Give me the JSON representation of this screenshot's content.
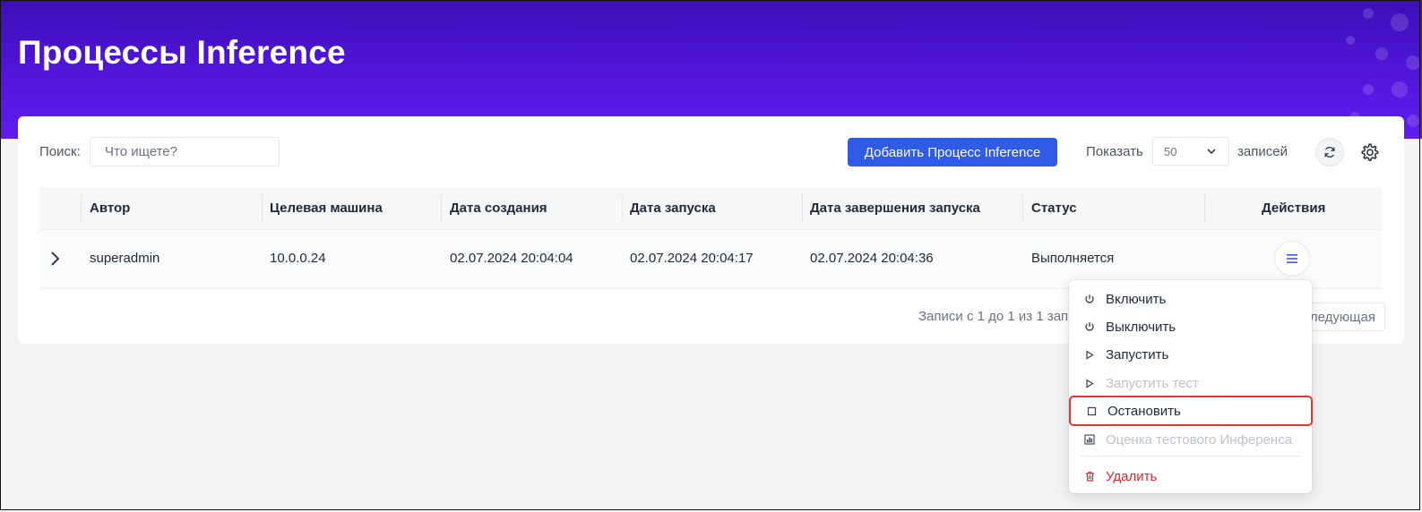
{
  "header": {
    "title": "Процессы Inference"
  },
  "toolbar": {
    "search_label": "Поиск:",
    "search_placeholder": "Что ищете?",
    "add_button": "Добавить Процесс Inference",
    "show_label": "Показать",
    "page_size": "50",
    "records_label": "записей"
  },
  "table": {
    "columns": [
      "Автор",
      "Целевая машина",
      "Дата создания",
      "Дата запуска",
      "Дата завершения запуска",
      "Статус",
      "Действия"
    ],
    "rows": [
      {
        "author": "superadmin",
        "target": "10.0.0.24",
        "created": "02.07.2024 20:04:04",
        "started": "02.07.2024 20:04:17",
        "finished": "02.07.2024 20:04:36",
        "status": "Выполняется"
      }
    ]
  },
  "pagination": {
    "info": "Записи с 1 до 1 из 1 записей",
    "next": "Следующая"
  },
  "action_menu": {
    "items": [
      {
        "label": "Включить",
        "icon": "power-icon",
        "state": "enabled"
      },
      {
        "label": "Выключить",
        "icon": "power-icon",
        "state": "enabled"
      },
      {
        "label": "Запустить",
        "icon": "play-icon",
        "state": "enabled"
      },
      {
        "label": "Запустить тест",
        "icon": "play-icon",
        "state": "disabled"
      },
      {
        "label": "Остановить",
        "icon": "stop-icon",
        "state": "highlighted"
      },
      {
        "label": "Оценка тестового Инференса",
        "icon": "chart-icon",
        "state": "disabled"
      },
      {
        "label": "Удалить",
        "icon": "trash-icon",
        "state": "danger"
      }
    ]
  },
  "colors": {
    "header_gradient_top": "#3b0fb8",
    "header_gradient_bottom": "#5f1cf0",
    "primary_button": "#2f5be6",
    "danger": "#dc2626",
    "highlight_outline": "#d93a32"
  }
}
